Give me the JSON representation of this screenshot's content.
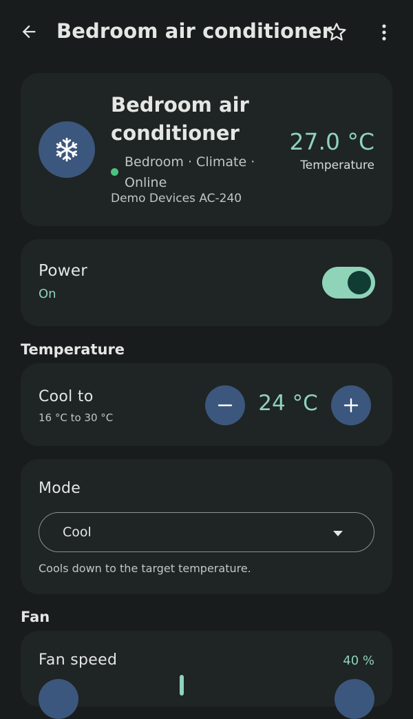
{
  "appbar": {
    "title": "Bedroom air conditioner",
    "back_icon": "arrow-back-icon",
    "favorite_icon": "star-outline-icon",
    "more_icon": "more-vert-icon"
  },
  "device": {
    "name": "Bedroom air conditioner",
    "icon": "snowflake-icon",
    "location": "Bedroom · Climate · Online",
    "model": "Demo Devices AC-240",
    "temperature_value": "27.0 °C",
    "temperature_label": "Temperature",
    "status_color": "#4cc27f"
  },
  "power": {
    "label": "Power",
    "state": "On",
    "enabled": true
  },
  "sections": {
    "temperature": "Temperature",
    "fan": "Fan"
  },
  "cool_to": {
    "label": "Cool to",
    "range": "16 °C to 30 °C",
    "value": "24 °C"
  },
  "mode": {
    "label": "Mode",
    "selected": "Cool",
    "help": "Cools down to the target temperature."
  },
  "fan_speed": {
    "label": "Fan speed",
    "value": "40 %",
    "level": 0.4
  },
  "colors": {
    "background": "#191c1c",
    "card": "#1f2424",
    "accent": "#8fd3b8",
    "button": "#3c577d"
  }
}
